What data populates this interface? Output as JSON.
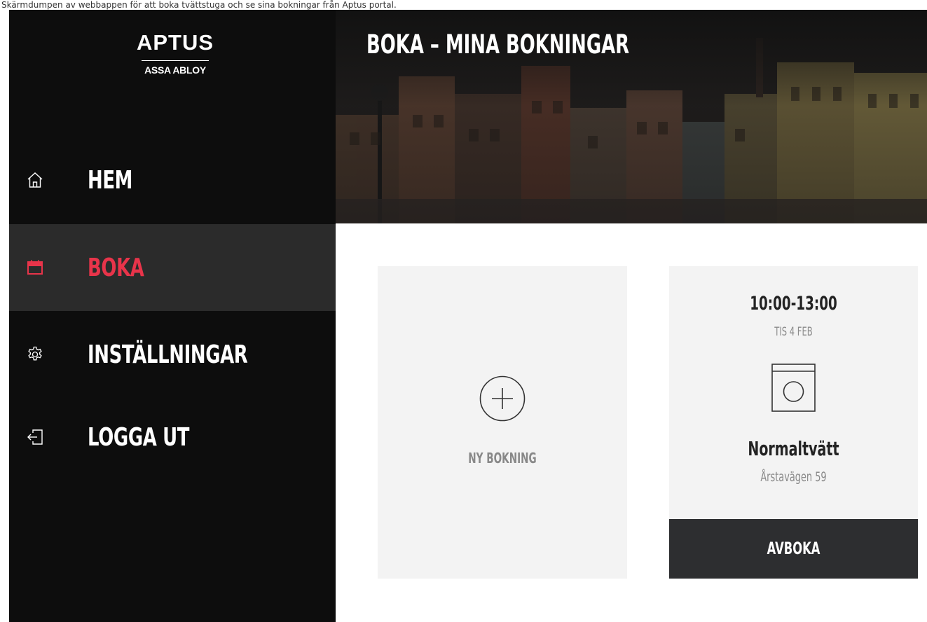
{
  "caption": "Skärmdumpen av webbappen för att boka tvättstuga och se sina bokningar från Aptus portal.",
  "logo": {
    "brand": "APTUS",
    "sub": "ASSA ABLOY"
  },
  "nav": {
    "items": [
      {
        "label": "HEM",
        "icon": "home-icon",
        "active": false
      },
      {
        "label": "BOKA",
        "icon": "calendar-icon",
        "active": true
      },
      {
        "label": "INSTÄLLNINGAR",
        "icon": "gear-icon",
        "active": false
      },
      {
        "label": "LOGGA UT",
        "icon": "logout-icon",
        "active": false
      }
    ]
  },
  "header": {
    "title": "BOKA – MINA BOKNINGAR"
  },
  "new_booking": {
    "label": "NY BOKNING",
    "icon": "plus-circle-icon"
  },
  "booking": {
    "time": "10:00-13:00",
    "date": "TIS 4 FEB",
    "icon": "washing-machine-icon",
    "program": "Normaltvätt",
    "address": "Årstavägen 59",
    "cancel_label": "AVBOKA"
  },
  "colors": {
    "sidebar_bg": "#0d0d0d",
    "active_bg": "#2b2b2b",
    "accent": "#e8344a",
    "card_bg": "#f3f3f3",
    "button_bg": "#2d2e30"
  }
}
